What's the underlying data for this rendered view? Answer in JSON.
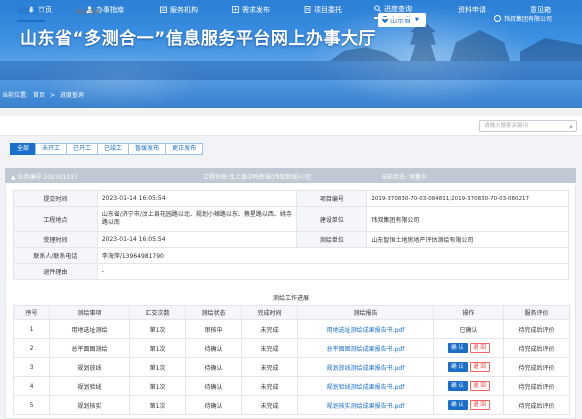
{
  "header": {
    "title": "山东省“多测合一”信息服务平台网上办事大厅",
    "location": "山东省",
    "user": "玮叔集团有限公司"
  },
  "nav": [
    {
      "label": "首页",
      "icon": "home-icon"
    },
    {
      "label": "办事指南",
      "icon": "guide-icon"
    },
    {
      "label": "服务机构",
      "icon": "org-icon"
    },
    {
      "label": "需求发布",
      "icon": "publish-icon"
    },
    {
      "label": "项目委托",
      "icon": "delegate-icon"
    },
    {
      "label": "进度查询",
      "icon": "search-icon"
    },
    {
      "label": "资料申请",
      "icon": ""
    },
    {
      "label": "意见箱",
      "icon": ""
    }
  ],
  "breadcrumb": {
    "prefix": "当前位置:",
    "home": "首页",
    "sep": ">",
    "current": "进度查询"
  },
  "tabs": {
    "active": "进度查询",
    "inactive": "确认成果"
  },
  "search": {
    "placeholder": "请输入搜索关键词"
  },
  "filters": [
    "全部",
    "未开工",
    "已开工",
    "已竣工",
    "暂缓发布",
    "更正发布"
  ],
  "business": {
    "number": "▲ 业务编号:202301037",
    "project_name": "工程名称:汶上县中鸣新城(玮叔新城)小区",
    "status": "当前状态: 测量中"
  },
  "info": {
    "submit_time_label": "提交时间",
    "submit_time": "2023-01-14 16:05:54",
    "project_no_label": "项目编号",
    "project_no": "2019-370830-70-03-084811;2019-370830-70-03-080217",
    "location_label": "工程地点",
    "location": "山东省/济宁市/汶上县花园路以北、规划小辣路以东、蔡星路以西、姚寺路以南",
    "builder_label": "建设单位",
    "builder": "玮叔集团有限公司",
    "accept_time_label": "受理时间",
    "accept_time": "2023-01-14 16:05:54",
    "surveyor_label": "测绘单位",
    "surveyor": "山东智恒土地房地产评估测绘有限公司",
    "contact_label": "联系人/联系电话",
    "contact": "李海萍/13964981790",
    "return_label": "退件理由",
    "return_reason": "-"
  },
  "progress": {
    "title": "测绘工作进展",
    "columns": [
      "序号",
      "测绘事项",
      "汇交次数",
      "测绘状态",
      "完成时间",
      "测绘报告",
      "操作",
      "服务评价"
    ],
    "rows": [
      {
        "no": "1",
        "item": "用地选址测绘",
        "times": "第1次",
        "status": "审核中",
        "done": "未完成",
        "report": "用地选址测绘成果报告书.pdf",
        "op": "已确认",
        "eval": "待完成后评价"
      },
      {
        "no": "2",
        "item": "总平面图测绘",
        "times": "第1次",
        "status": "待确认",
        "done": "未完成",
        "report": "总平面图测绘成果报告书.pdf",
        "op_ok": "确 认",
        "op_back": "退 回",
        "eval": "待完成后评价"
      },
      {
        "no": "3",
        "item": "规划放线",
        "times": "第1次",
        "status": "待确认",
        "done": "未完成",
        "report": "规划放线测绘成果报告书.pdf",
        "op_ok": "确 认",
        "op_back": "退 回",
        "eval": "待完成后评价"
      },
      {
        "no": "4",
        "item": "规划验线",
        "times": "第1次",
        "status": "待确认",
        "done": "未完成",
        "report": "规划验线测绘成果报告书.pdf",
        "op_ok": "确 认",
        "op_back": "退 回",
        "eval": "待完成后评价"
      },
      {
        "no": "5",
        "item": "规划核实",
        "times": "第1次",
        "status": "待确认",
        "done": "未完成",
        "report": "规划核实测绘成果报告书.pdf",
        "op_ok": "确 认",
        "op_back": "退 回",
        "eval": "待完成后评价"
      }
    ]
  }
}
